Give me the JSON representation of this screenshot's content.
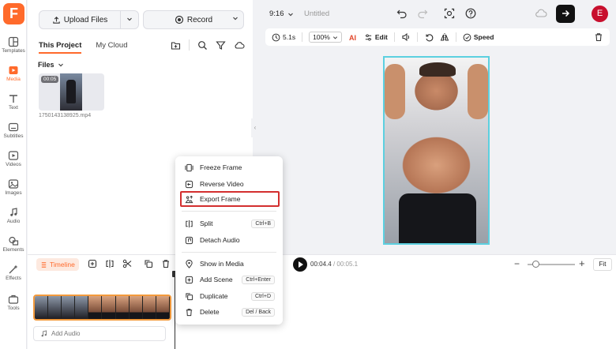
{
  "app": {
    "logo_letter": "F",
    "accent_color": "#ff6a2b"
  },
  "rail": {
    "items": [
      {
        "label": "Templates",
        "icon": "templates-icon"
      },
      {
        "label": "Media",
        "icon": "media-icon",
        "active": true
      },
      {
        "label": "Text",
        "icon": "text-icon"
      },
      {
        "label": "Subtitles",
        "icon": "subtitles-icon"
      },
      {
        "label": "Videos",
        "icon": "videos-icon"
      },
      {
        "label": "Images",
        "icon": "images-icon"
      },
      {
        "label": "Audio",
        "icon": "audio-icon"
      },
      {
        "label": "Elements",
        "icon": "elements-icon"
      },
      {
        "label": "Effects",
        "icon": "effects-icon"
      },
      {
        "label": "Tools",
        "icon": "tools-icon"
      }
    ]
  },
  "media_panel": {
    "upload_label": "Upload Files",
    "record_label": "Record",
    "tabs": [
      "This Project",
      "My Cloud"
    ],
    "files_label": "Files",
    "file": {
      "duration": "00:05",
      "name": "1750143138925.mp4"
    }
  },
  "topbar": {
    "ratio": "9:16",
    "project_title": "Untitled",
    "avatar_letter": "E"
  },
  "edit_toolbar": {
    "duration": "5.1s",
    "zoom": "100%",
    "edit_label": "Edit",
    "speed_label": "Speed"
  },
  "timeline": {
    "tag_label": "Timeline",
    "current_time": "00:04.4",
    "total_time": "/ 00:05.1",
    "fit_label": "Fit",
    "add_audio_label": "Add Audio"
  },
  "context_menu": {
    "items": [
      {
        "label": "Freeze Frame",
        "icon": "freeze-frame-icon"
      },
      {
        "label": "Reverse Video",
        "icon": "reverse-video-icon"
      },
      {
        "label": "Export Frame",
        "icon": "export-frame-icon",
        "highlighted": true,
        "highlight_color": "#d32f2f"
      },
      {
        "label": "Split",
        "icon": "split-icon",
        "shortcut": "Ctrl+B"
      },
      {
        "label": "Detach Audio",
        "icon": "detach-audio-icon"
      },
      {
        "label": "Show in Media",
        "icon": "show-in-media-icon"
      },
      {
        "label": "Add Scene",
        "icon": "add-scene-icon",
        "shortcut": "Ctrl+Enter"
      },
      {
        "label": "Duplicate",
        "icon": "duplicate-icon",
        "shortcut": "Ctrl+D"
      },
      {
        "label": "Delete",
        "icon": "delete-icon",
        "shortcut": "Del / Back"
      }
    ]
  }
}
